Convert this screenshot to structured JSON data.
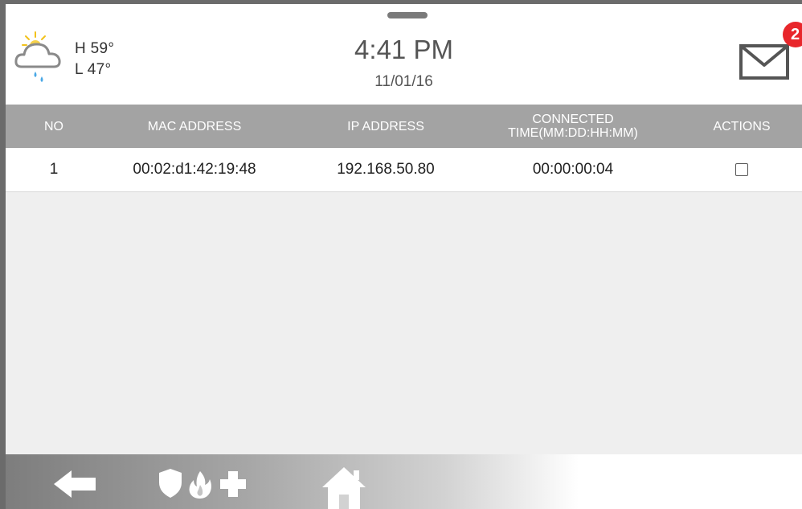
{
  "weather": {
    "icon": "partly-cloudy-rain-icon",
    "high": "H 59°",
    "low": "L 47°"
  },
  "clock": {
    "time": "4:41 PM",
    "date": "11/01/16"
  },
  "messages": {
    "icon": "mail-icon",
    "unread_count": "2",
    "badge_color": "#e8262b"
  },
  "table": {
    "headers": {
      "no": "NO",
      "mac": "MAC ADDRESS",
      "ip": "IP ADDRESS",
      "connected": "CONNECTED TIME(MM:DD:HH:MM)",
      "actions": "ACTIONS"
    },
    "rows": [
      {
        "no": "1",
        "mac": "00:02:d1:42:19:48",
        "ip": "192.168.50.80",
        "connected": "00:00:00:04",
        "selected": false
      }
    ],
    "header_color": "#a3a3a3"
  },
  "footer": {
    "icons": [
      "back-arrow-icon",
      "police-shield-icon",
      "fire-flame-icon",
      "medical-cross-icon",
      "home-icon"
    ]
  }
}
